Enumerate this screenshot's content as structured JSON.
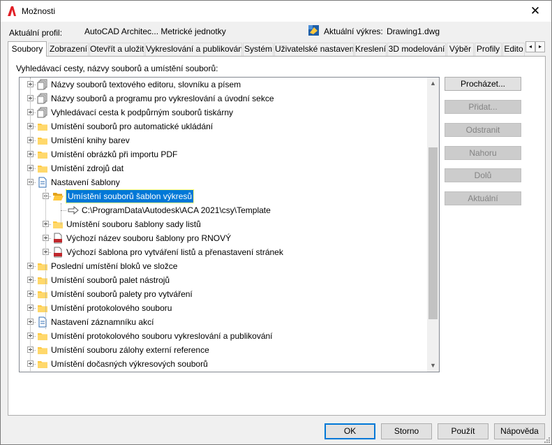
{
  "window": {
    "title": "Možnosti",
    "close_glyph": "✕",
    "app_icon": "autocad-a-icon"
  },
  "profile": {
    "current_profile_label": "Aktuální profil:",
    "current_profile_value": "AutoCAD Architec... Metrické jednotky",
    "current_drawing_label": "Aktuální výkres:",
    "current_drawing_value": "Drawing1.dwg"
  },
  "tabs": [
    {
      "label": "Soubory",
      "active": true
    },
    {
      "label": "Zobrazení"
    },
    {
      "label": "Otevřít a uložit"
    },
    {
      "label": "Vykreslování a publikování"
    },
    {
      "label": "Systém"
    },
    {
      "label": "Uživatelské nastavení"
    },
    {
      "label": "Kreslení"
    },
    {
      "label": "3D modelování"
    },
    {
      "label": "Výběr"
    },
    {
      "label": "Profily"
    },
    {
      "label": "Edito"
    }
  ],
  "tab_scroll": {
    "left": "◂",
    "right": "▸"
  },
  "panel": {
    "caption": "Vyhledávací cesty, názvy souborů a umístění souborů:"
  },
  "tree": {
    "items": [
      {
        "label": "Názvy souborů textového editoru, slovníku a písem",
        "icon": "files-stack-icon",
        "level": 0,
        "expanded": false
      },
      {
        "label": "Názvy souborů a programu pro vykreslování a úvodní sekce",
        "icon": "files-stack-icon",
        "level": 0,
        "expanded": false
      },
      {
        "label": "Vyhledávací cesta k podpůrným souborů tiskárny",
        "icon": "files-stack-icon",
        "level": 0,
        "expanded": false
      },
      {
        "label": "Umístění souborů pro automatické ukládání",
        "icon": "folder-icon",
        "level": 0,
        "expanded": false
      },
      {
        "label": "Umístění knihy barev",
        "icon": "folder-icon",
        "level": 0,
        "expanded": false
      },
      {
        "label": "Umístění obrázků při importu PDF",
        "icon": "folder-icon",
        "level": 0,
        "expanded": false
      },
      {
        "label": "Umístění zdrojů dat",
        "icon": "folder-icon",
        "level": 0,
        "expanded": false
      },
      {
        "label": "Nastavení šablony",
        "icon": "document-icon",
        "level": 0,
        "expanded": true
      },
      {
        "label": "Umístění souborů šablon výkresů",
        "icon": "open-folder-icon",
        "level": 1,
        "expanded": true,
        "selected": true
      },
      {
        "label": "C:\\ProgramData\\Autodesk\\ACA 2021\\csy\\Template",
        "icon": "path-arrow-icon",
        "level": 2,
        "leaf": true
      },
      {
        "label": "Umístění souboru šablony sady listů",
        "icon": "folder-icon",
        "level": 1,
        "expanded": false
      },
      {
        "label": "Výchozí název souboru šablony pro RNOVÝ",
        "icon": "dwt-file-icon",
        "level": 1,
        "expanded": false
      },
      {
        "label": "Výchozí šablona pro vytváření listů a přenastavení stránek",
        "icon": "dwt-file-icon",
        "level": 1,
        "expanded": false
      },
      {
        "label": "Poslední umístění bloků ve složce",
        "icon": "folder-icon",
        "level": 0,
        "expanded": false
      },
      {
        "label": "Umístění souborů palet nástrojů",
        "icon": "folder-icon",
        "level": 0,
        "expanded": false
      },
      {
        "label": "Umístění souborů palety pro vytváření",
        "icon": "folder-icon",
        "level": 0,
        "expanded": false
      },
      {
        "label": "Umístění protokolového souboru",
        "icon": "folder-icon",
        "level": 0,
        "expanded": false
      },
      {
        "label": "Nastavení záznamníku akcí",
        "icon": "document-icon",
        "level": 0,
        "expanded": false
      },
      {
        "label": "Umístění protokolového souboru vykreslování a publikování",
        "icon": "folder-icon",
        "level": 0,
        "expanded": false
      },
      {
        "label": "Umístění souboru zálohy externí reference",
        "icon": "folder-icon",
        "level": 0,
        "expanded": false
      },
      {
        "label": "Umístění dočasných výkresových souborů",
        "icon": "folder-icon",
        "level": 0,
        "expanded": false
      }
    ]
  },
  "scrollbar": {
    "up": "▲",
    "down": "▼"
  },
  "side_buttons": [
    {
      "label": "Procházet...",
      "enabled": true
    },
    {
      "label": "Přidat...",
      "enabled": false
    },
    {
      "label": "Odstranit",
      "enabled": false
    },
    {
      "label": "Nahoru",
      "enabled": false
    },
    {
      "label": "Dolů",
      "enabled": false
    },
    {
      "label": "Aktuální",
      "enabled": false
    }
  ],
  "footer": {
    "ok": "OK",
    "cancel": "Storno",
    "apply": "Použít",
    "help": "Nápověda"
  },
  "colors": {
    "selection": "#0078d7",
    "folder": "#ffc83d",
    "dwt": "#c0282d"
  }
}
